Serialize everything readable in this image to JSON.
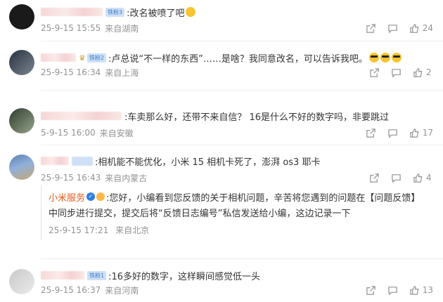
{
  "comments": [
    {
      "badge": "铁粉3",
      "text": ":改名被喷了吧",
      "date": "25-9-15 15:55",
      "location": "来自湖南",
      "likes": "24",
      "colors": [
        "#3a3a3a",
        "#111111"
      ]
    },
    {
      "badge": "铁粉2",
      "text": ":卢总说“不一样的东西”……是啥？我同意改名，可以告诉我吧。",
      "date": "25-9-15 16:34",
      "location": "来自上海",
      "likes": "2",
      "colors": [
        "#2e3a4a",
        "#6b7480"
      ]
    },
    {
      "badge": "",
      "text": ":车卖那么好，还带不来自信？ 16是什么不好的数字吗，非要跳过",
      "date": "5-9-15 16:00",
      "location": "来自安徽",
      "likes": "17",
      "colors": [
        "#3b4a3a",
        "#8a9a80"
      ]
    },
    {
      "badge": "",
      "text": ":相机能不能优化，小米 15 相机卡死了，澎湃 os3 耶卡",
      "date": "25-9-15 16:43",
      "location": "来自内蒙古",
      "likes": "4",
      "colors": [
        "#5c7fb0",
        "#c8a878"
      ]
    },
    {
      "badge": "铁粉1",
      "text": ":16多好的数字，这样瞬间感觉低一头",
      "date": "25-9-15 16:37",
      "location": "来自河南",
      "likes": "13",
      "colors": [
        "#cfcfcf",
        "#e6e6e6"
      ]
    }
  ],
  "reply": {
    "name": "小米服务",
    "line1": ":您好，小编看到您反馈的关于相机问题，辛苦将您遇到的问题在【问题反馈】",
    "line2": "中同步进行提交，提交后将“反馈日志编号”私信发送给小编，这边记录一下",
    "date": "25-9-15 17:21",
    "location": "来自北京"
  },
  "icons": {
    "share": "share-icon",
    "comment": "comment-icon",
    "like": "like-icon"
  },
  "colors": {
    "muted": "#939393",
    "reply_name": "#e85e1b",
    "badge_bg": "#cfe0f6",
    "verified": "#2f7fe0"
  }
}
